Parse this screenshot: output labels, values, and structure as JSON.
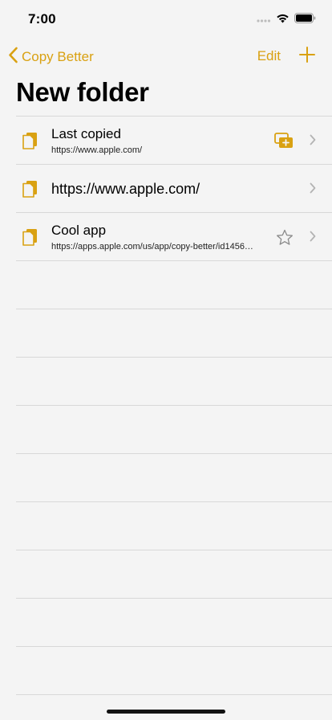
{
  "status_bar": {
    "time": "7:00"
  },
  "nav": {
    "back_label": "Copy Better",
    "edit_label": "Edit"
  },
  "page": {
    "title": "New folder"
  },
  "rows": [
    {
      "title": "Last copied",
      "subtitle": "https://www.apple.com/",
      "accessory": "stacked-add-icon"
    },
    {
      "title": "https://www.apple.com/",
      "subtitle": "",
      "accessory": ""
    },
    {
      "title": "Cool app",
      "subtitle": "https://apps.apple.com/us/app/copy-better/id1456…",
      "accessory": "star-icon"
    }
  ],
  "colors": {
    "accent": "#d9a112",
    "background": "#f4f4f4",
    "separator": "#d8d8d8",
    "chevron": "#b3b3b3"
  }
}
